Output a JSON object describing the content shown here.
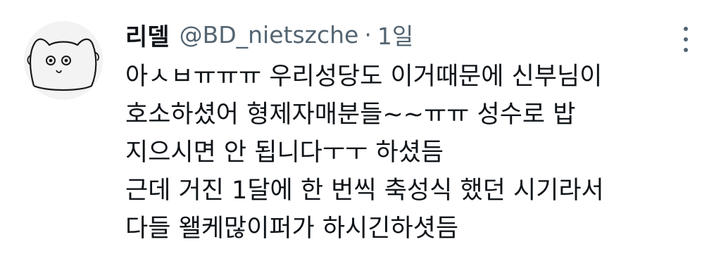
{
  "tweet": {
    "display_name": "리델",
    "handle": "@BD_nietszche",
    "separator": "·",
    "time": "1일",
    "more_icon": "more-vertical-icon",
    "avatar_icon": "cat-doodle-avatar",
    "lines": [
      "아ㅅㅂㅠㅠㅠ 우리성당도 이거때문에 신부님이",
      "호소하셨어 형제자매분들~~ㅠㅠ 성수로 밥",
      "지으시면 안 됩니다ㅜㅜ 하셨듬",
      "근데 거진 1달에 한 번씩 축성식 했던 시기라서",
      "다들 왤케많이퍼가 하시긴하셧듬"
    ]
  }
}
